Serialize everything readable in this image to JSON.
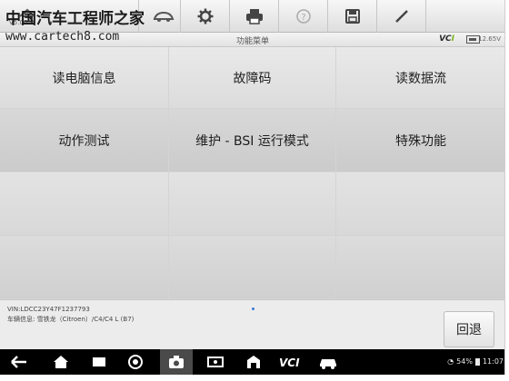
{
  "toolbar": {
    "version": "V5.00",
    "buttons": [
      "home",
      "vehicle-swap",
      "settings",
      "print",
      "help",
      "save",
      "edit"
    ]
  },
  "watermark": {
    "text_cn": "中国汽车工程师之家",
    "url": "www.cartech8.com"
  },
  "header": {
    "title": "功能菜单",
    "vci_label_main": "VC",
    "vci_label_accent": "I",
    "voltage": "12.65V"
  },
  "menu": {
    "items": [
      {
        "label": "读电脑信息"
      },
      {
        "label": "故障码"
      },
      {
        "label": "读数据流"
      },
      {
        "label": "动作测试"
      },
      {
        "label": "维护 - BSI 运行模式"
      },
      {
        "label": "特殊功能"
      },
      {
        "label": ""
      },
      {
        "label": ""
      },
      {
        "label": ""
      },
      {
        "label": ""
      },
      {
        "label": ""
      },
      {
        "label": ""
      }
    ]
  },
  "footer": {
    "vin": "VIN:LDCC23Y47F1237793",
    "vehicle_info": "车辆信息: 雪铁龙（Citroen）/C4/C4 L (B7)",
    "back_label": "回退"
  },
  "status_bar": {
    "battery_text": "54%",
    "time": "11:07"
  },
  "colors": {
    "vci_accent": "#7ab317",
    "page_dot": "#3a7bd5"
  }
}
